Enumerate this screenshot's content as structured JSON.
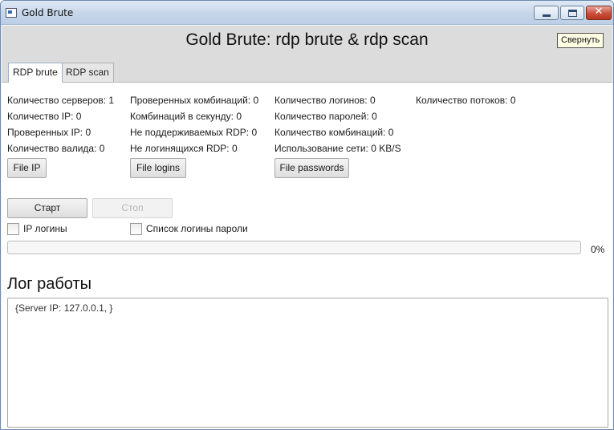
{
  "window": {
    "title": "Gold Brute"
  },
  "header": {
    "title": "Gold Brute: rdp brute & rdp scan",
    "collapse_label": "Свернуть"
  },
  "tabs": [
    {
      "label": "RDP brute",
      "active": true
    },
    {
      "label": "RDP scan",
      "active": false
    }
  ],
  "stats": {
    "col1": [
      "Количество серверов: 1",
      "Количество IP: 0",
      "Проверенных IP: 0",
      "Количество валида: 0"
    ],
    "col2": [
      "Проверенных комбинаций: 0",
      "Комбинаций в секунду: 0",
      "Не поддерживаемых RDP: 0",
      "Не логинящихся RDP: 0"
    ],
    "col3": [
      "Количество логинов: 0",
      "Количество паролей: 0",
      "Количество комбинаций: 0",
      "Использование сети: 0 KB/S"
    ],
    "col4": [
      "Количество потоков: 0"
    ]
  },
  "buttons": {
    "file_ip": "File IP",
    "file_logins": "File logins",
    "file_passwords": "File passwords",
    "start": "Старт",
    "stop": "Стоп"
  },
  "checkboxes": {
    "ip_logins": {
      "label": "IP логины",
      "checked": false
    },
    "list_logins_passwords": {
      "label": "Список логины пароли",
      "checked": false
    }
  },
  "progress": {
    "value": 0,
    "label": "0%"
  },
  "log": {
    "title": "Лог работы",
    "text": "{Server IP: 127.0.0.1, }"
  },
  "colors": {
    "header_bg": "#dcdcdc",
    "titlebar": "#c6d6ea",
    "close_button": "#c9503b"
  }
}
